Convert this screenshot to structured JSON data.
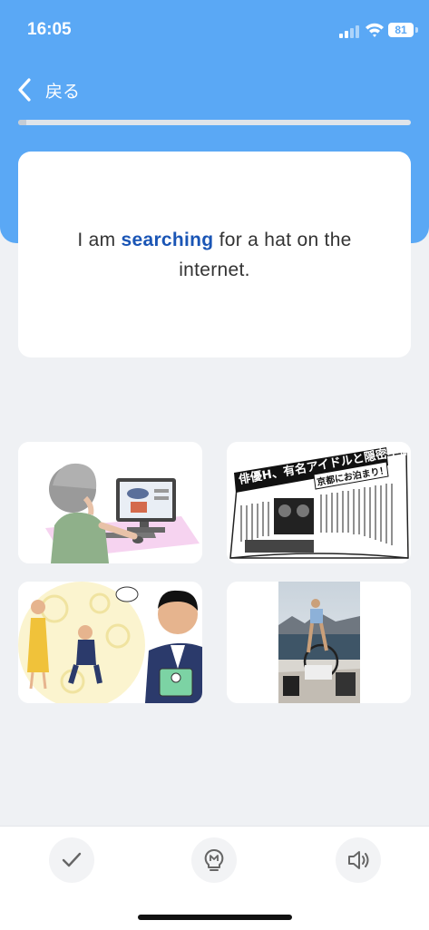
{
  "status_bar": {
    "time": "16:05",
    "battery": "81"
  },
  "nav": {
    "back_label": "戻る"
  },
  "progress": {
    "fraction": 0.02
  },
  "card": {
    "sentence_before": "I am",
    "keyword": "searching",
    "sentence_after": "for a hat on the internet."
  },
  "choices": [
    {
      "icon": "woman-at-computer-illustration"
    },
    {
      "icon": "newspaper-illustration",
      "headline": "俳優H、有名アイドルと隠密不倫！",
      "subhead": "京都にお泊まり！"
    },
    {
      "icon": "proposal-illustration"
    },
    {
      "icon": "woman-on-boat-photo"
    }
  ],
  "actions": [
    {
      "icon": "check-icon"
    },
    {
      "icon": "hint-bulb-icon"
    },
    {
      "icon": "speaker-icon"
    }
  ],
  "colors": {
    "header": "#5aa8f5",
    "keyword": "#1a55b5",
    "background": "#eff1f4"
  }
}
